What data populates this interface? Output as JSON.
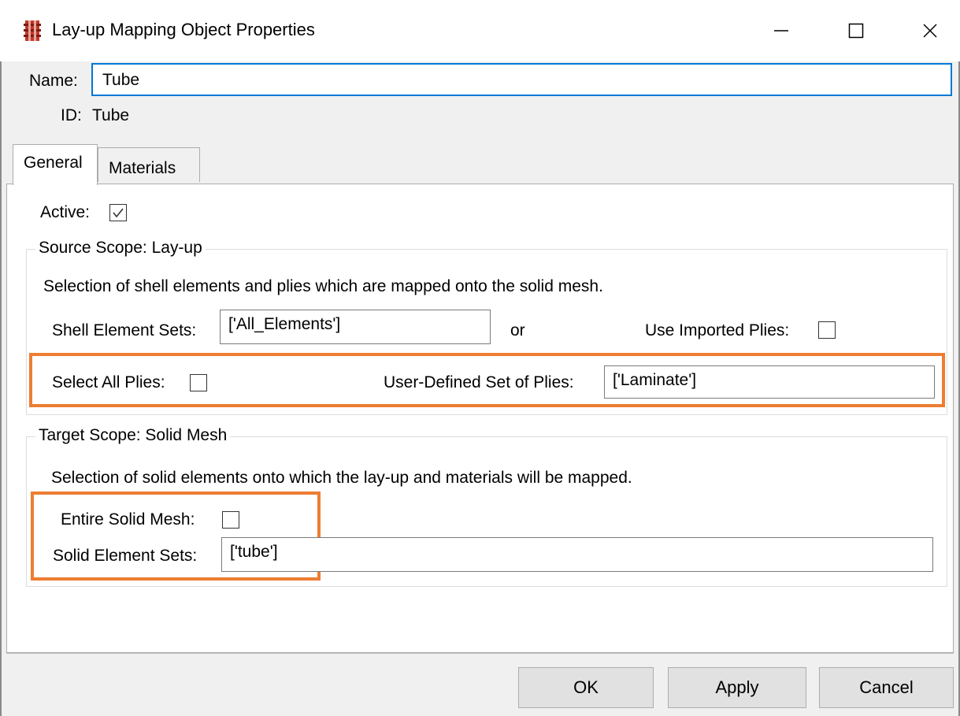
{
  "window": {
    "title": "Lay-up Mapping Object Properties",
    "icon": "lay-up-mapping-icon",
    "controls": [
      "minimize-icon",
      "maximize-icon",
      "close-icon"
    ]
  },
  "header": {
    "name_label": "Name:",
    "name_value": "Tube",
    "id_label": "ID:",
    "id_value": "Tube"
  },
  "tabs": [
    {
      "label": "General",
      "selected": true
    },
    {
      "label": "Materials",
      "selected": false
    }
  ],
  "general": {
    "active_label": "Active:",
    "active_checked": true,
    "source": {
      "legend": "Source Scope: Lay-up",
      "description": "Selection of shell elements and plies which are mapped onto the solid mesh.",
      "shell_sets_label": "Shell Element Sets:",
      "shell_sets_value": "['All_Elements']",
      "or_text": "or",
      "use_imported_label": "Use Imported Plies:",
      "use_imported_checked": false,
      "select_all_label": "Select All Plies:",
      "select_all_checked": false,
      "user_defined_label": "User-Defined Set of Plies:",
      "user_defined_value": "['Laminate']"
    },
    "target": {
      "legend": "Target Scope: Solid Mesh",
      "description": "Selection of solid elements onto which the lay-up and materials will be mapped.",
      "entire_mesh_label": "Entire Solid Mesh:",
      "entire_mesh_checked": false,
      "solid_sets_label": "Solid Element Sets:",
      "solid_sets_value": "['tube']"
    }
  },
  "buttons": {
    "ok": "OK",
    "apply": "Apply",
    "cancel": "Cancel"
  },
  "colors": {
    "highlight": "#ed7d31",
    "focus_border": "#0078d7"
  }
}
